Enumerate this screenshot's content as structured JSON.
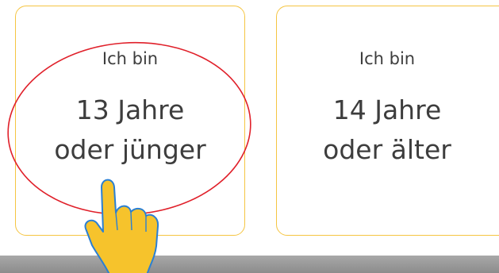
{
  "cards": [
    {
      "prefix": "Ich bin",
      "line1": "13 Jahre",
      "line2": "oder jünger"
    },
    {
      "prefix": "Ich bin",
      "line1": "14 Jahre",
      "line2": "oder älter"
    }
  ],
  "colors": {
    "card_border": "#f5c542",
    "highlight_circle": "#e0202a",
    "hand_fill": "#f6c32c",
    "hand_outline": "#2a7fd4",
    "text": "#3d3d3d"
  },
  "icons": {
    "pointer": "pointing-hand-icon",
    "highlight": "highlight-circle"
  }
}
